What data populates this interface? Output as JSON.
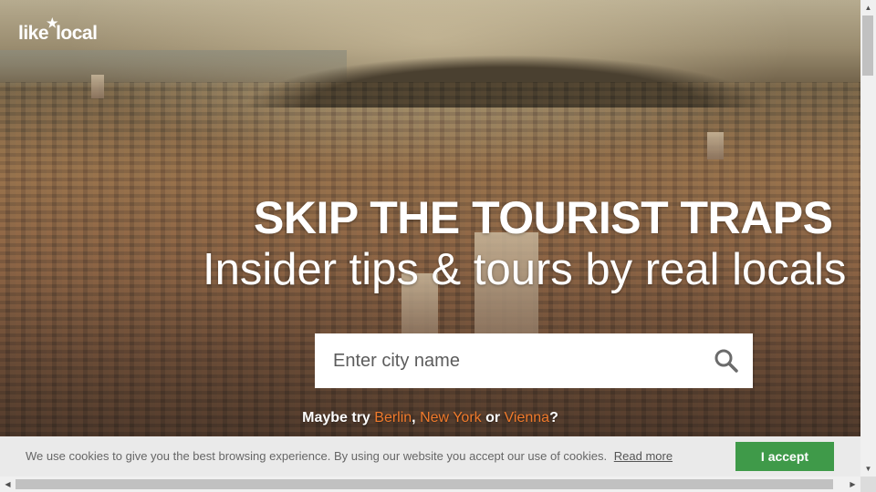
{
  "brand": {
    "logo_text_left": "like",
    "logo_star": "★",
    "logo_text_right": "local"
  },
  "hero": {
    "headline": "SKIP THE TOURIST TRAPS",
    "subline": "Insider tips & tours by real locals"
  },
  "search": {
    "placeholder": "Enter city name",
    "button_icon": "search-icon"
  },
  "suggestions": {
    "prefix": "Maybe try ",
    "city1": "Berlin",
    "sep1": ", ",
    "city2": "New York",
    "sep2": " or ",
    "city3": "Vienna",
    "suffix": "?"
  },
  "cookie": {
    "message": "We use cookies to give you the best browsing experience. By using our website you accept our use of cookies.",
    "read_more": "Read more",
    "accept_label": "I accept"
  },
  "colors": {
    "accent": "#f07a2b",
    "accept_button": "#3f9a49",
    "cookie_bar": "#eaeaea"
  }
}
